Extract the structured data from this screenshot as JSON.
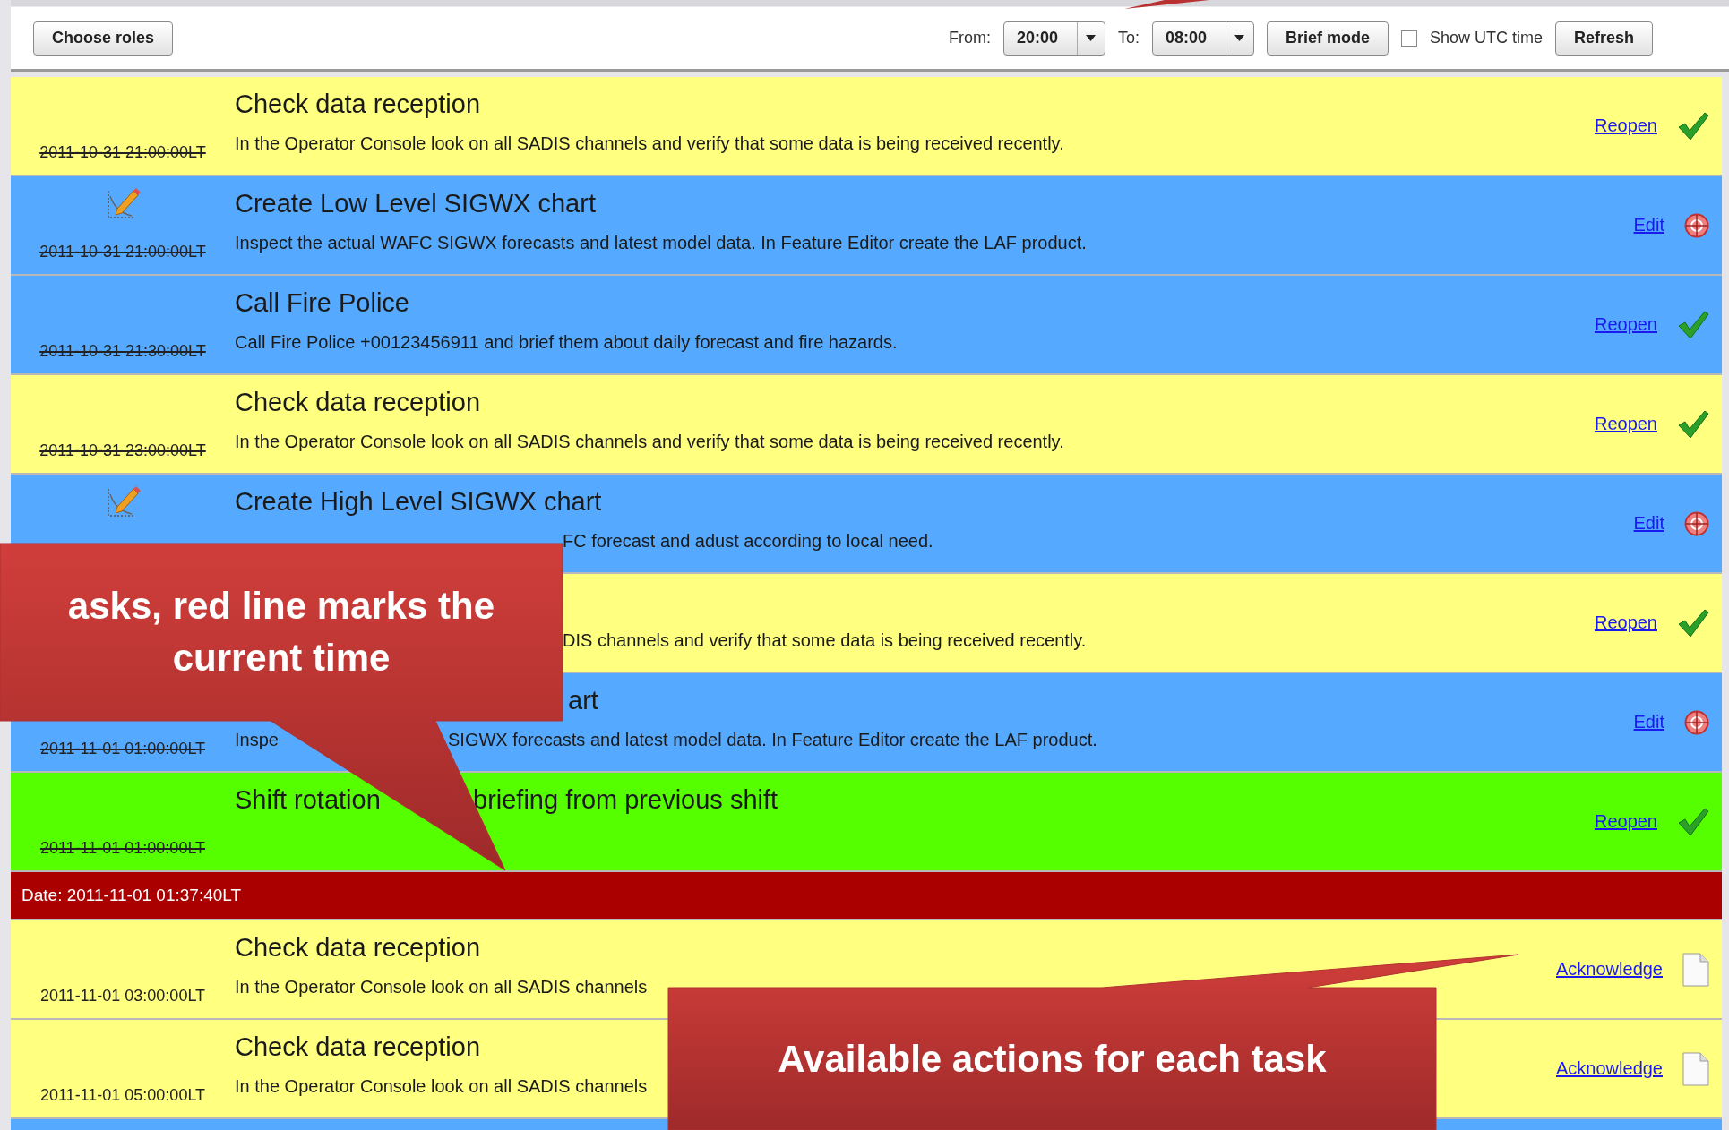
{
  "toolbar": {
    "choose_roles": "Choose roles",
    "from_label": "From:",
    "from_value": "20:00",
    "to_label": "To:",
    "to_value": "08:00",
    "brief_mode": "Brief mode",
    "show_utc": {
      "label": "Show UTC time",
      "checked": false
    },
    "refresh": "Refresh"
  },
  "tasks": [
    {
      "kind": "done",
      "color": "#ffff80",
      "title": [
        "Check data reception"
      ],
      "date": "2011-10-31 21:00:00LT",
      "description": [
        "In the Operator Console look on all SADIS channels and verify that some data is being received recently."
      ],
      "action": "Reopen"
    },
    {
      "kind": "editable",
      "color": "#55aaff",
      "title": [
        "Create Low Level SIGWX chart"
      ],
      "date": "2011-10-31 21:00:00LT",
      "description": [
        "Inspect the actual WAFC SIGWX forecasts and latest model data. In Feature Editor create the LAF product."
      ],
      "action": "Edit"
    },
    {
      "kind": "done",
      "color": "#55aaff",
      "title": [
        "Call Fire Police"
      ],
      "date": "2011-10-31 21:30:00LT",
      "description": [
        "Call Fire Police +00123456911 and brief them about daily forecast and fire hazards."
      ],
      "action": "Reopen"
    },
    {
      "kind": "done",
      "color": "#ffff80",
      "title": [
        "Check data reception"
      ],
      "date": "2011-10-31 23:00:00LT",
      "description": [
        "In the Operator Console look on all SADIS channels and verify that some data is being received recently."
      ],
      "action": "Reopen"
    },
    {
      "kind": "editable",
      "color": "#55aaff",
      "title": [
        "Create High Level SIGWX chart"
      ],
      "description": [
        "FC forecast and adust according to local need."
      ],
      "action": "Edit"
    },
    {
      "kind": "done",
      "color": "#ffff80",
      "description": [
        "DIS channels and verify that some data is being received recently."
      ],
      "action": "Reopen"
    },
    {
      "kind": "editable",
      "color": "#55aaff",
      "title": [
        "art"
      ],
      "date": "2011-11-01 01:00:00LT",
      "description": [
        "Inspe",
        "SIGWX forecasts and latest model data. In Feature Editor create the LAF product."
      ],
      "action": "Edit"
    },
    {
      "kind": "done",
      "color": "#55ff00",
      "title": [
        "Shift rotation",
        "briefing from previous shift"
      ],
      "date": "2011-11-01 01:00:00LT",
      "action": "Reopen"
    },
    {
      "kind": "now",
      "color": "#aa0000",
      "text": "Date: 2011-11-01 01:37:40LT"
    },
    {
      "kind": "pending",
      "color": "#ffff80",
      "title": [
        "Check data reception"
      ],
      "date": "2011-11-01 03:00:00LT",
      "description": [
        "In the Operator Console look on all SADIS channels"
      ],
      "action": "Acknowledge"
    },
    {
      "kind": "pending",
      "color": "#ffff80",
      "title": [
        "Check data reception"
      ],
      "date": "2011-11-01 05:00:00LT",
      "description": [
        "In the Operator Console look on all SADIS channels"
      ],
      "action": "Acknowledge"
    },
    {
      "kind": "cut",
      "color": "#55aaff"
    }
  ],
  "callouts": [
    "asks, red line marks the\ncurrent time",
    "Available actions for each task"
  ]
}
